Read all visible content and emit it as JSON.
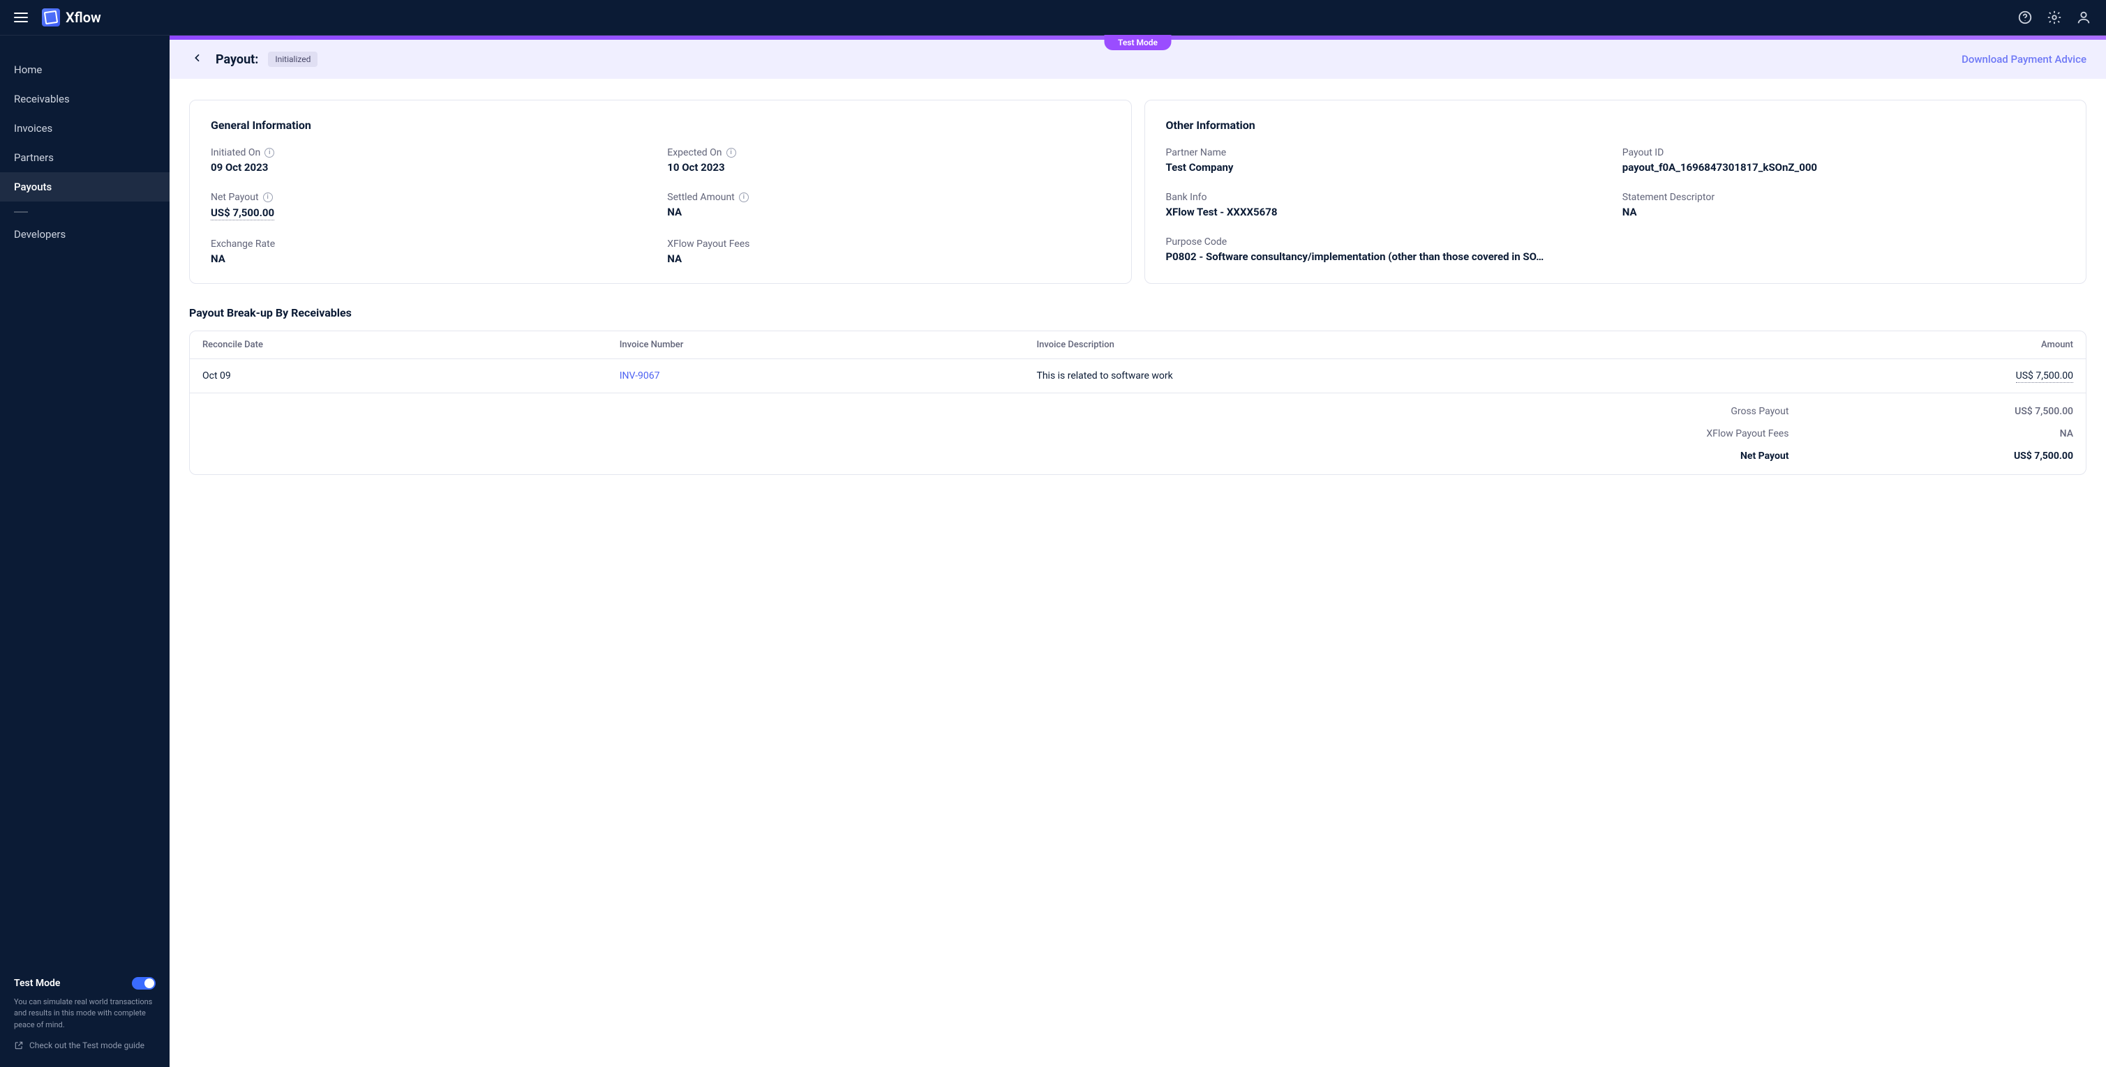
{
  "brand": "Xflow",
  "topbar": {
    "mode_chip": "Test Mode"
  },
  "sidebar": {
    "items": [
      {
        "label": "Home"
      },
      {
        "label": "Receivables"
      },
      {
        "label": "Invoices"
      },
      {
        "label": "Partners"
      },
      {
        "label": "Payouts",
        "active": true
      }
    ],
    "devs": "Developers",
    "test_mode": {
      "label": "Test Mode",
      "desc": "You can simulate real world transactions and results in this mode with complete peace of mind.",
      "guide_link": "Check out the Test mode guide"
    }
  },
  "subheader": {
    "title": "Payout:",
    "status": "Initialized",
    "download": "Download Payment Advice"
  },
  "general": {
    "title": "General Information",
    "initiated_on": {
      "label": "Initiated On",
      "value": "09 Oct 2023"
    },
    "expected_on": {
      "label": "Expected On",
      "value": "10 Oct 2023"
    },
    "net_payout": {
      "label": "Net Payout",
      "value": "US$ 7,500.00"
    },
    "settled_amount": {
      "label": "Settled Amount",
      "value": "NA"
    },
    "exchange_rate": {
      "label": "Exchange Rate",
      "value": "NA"
    },
    "xflow_fees": {
      "label": "XFlow Payout Fees",
      "value": "NA"
    }
  },
  "other": {
    "title": "Other Information",
    "partner_name": {
      "label": "Partner Name",
      "value": "Test Company"
    },
    "payout_id": {
      "label": "Payout ID",
      "value": "payout_f0A_1696847301817_kSOnZ_000"
    },
    "bank_info": {
      "label": "Bank Info",
      "value": "XFlow Test - XXXX5678"
    },
    "statement": {
      "label": "Statement Descriptor",
      "value": "NA"
    },
    "purpose": {
      "label": "Purpose Code",
      "value": "P0802 - Software consultancy/implementation (other than those covered in SO…"
    }
  },
  "breakup": {
    "title": "Payout Break-up By Receivables",
    "columns": {
      "date": "Reconcile Date",
      "invoice": "Invoice Number",
      "desc": "Invoice Description",
      "amount": "Amount"
    },
    "rows": [
      {
        "date": "Oct 09",
        "invoice": "INV-9067",
        "desc": "This is related to software work",
        "amount": "US$ 7,500.00"
      }
    ],
    "summary": {
      "gross": {
        "label": "Gross Payout",
        "value": "US$ 7,500.00"
      },
      "fees": {
        "label": "XFlow Payout Fees",
        "value": "NA"
      },
      "net": {
        "label": "Net Payout",
        "value": "US$ 7,500.00"
      }
    }
  }
}
